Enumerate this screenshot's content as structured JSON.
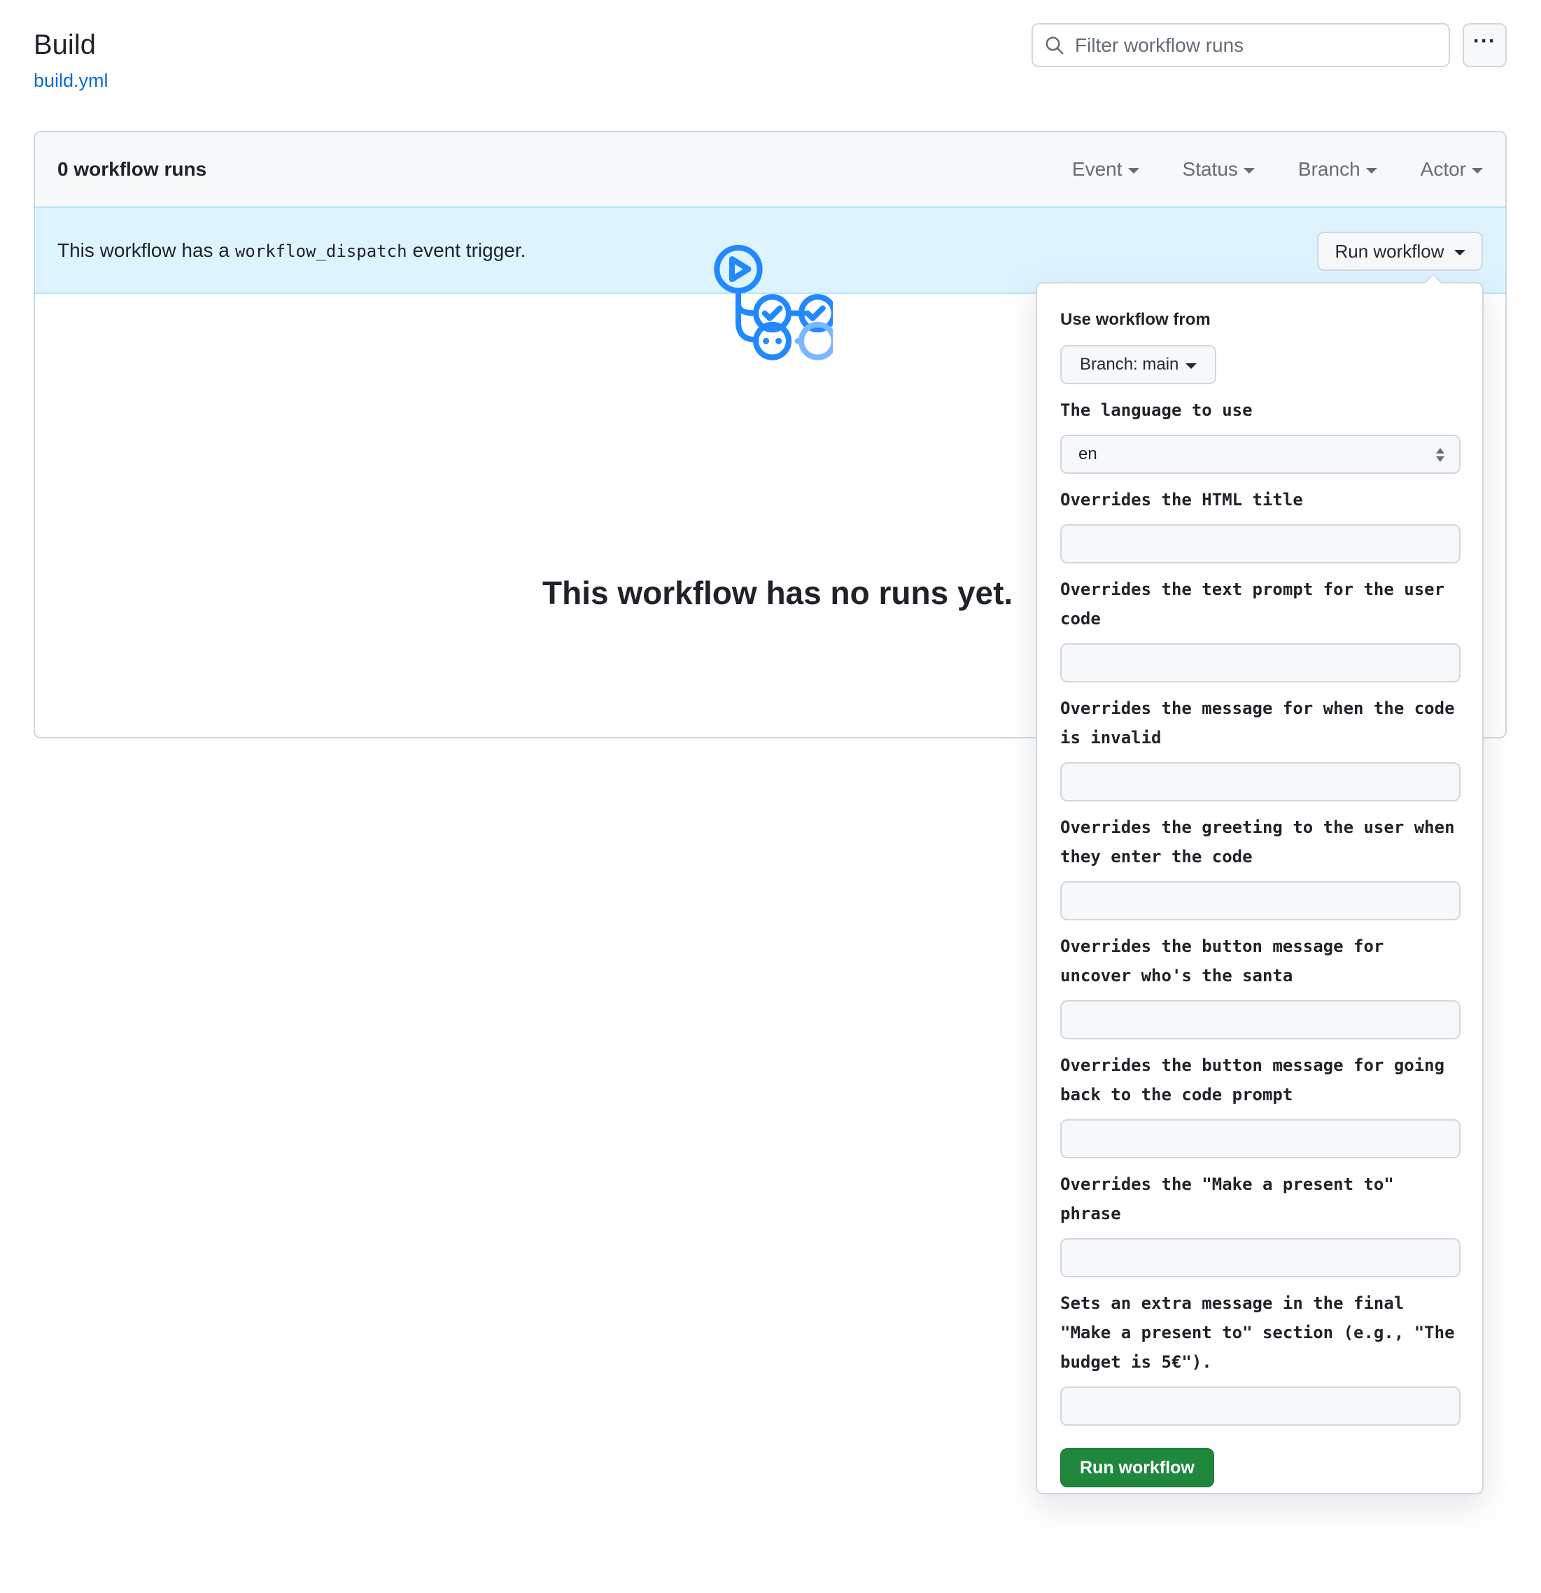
{
  "header": {
    "title": "Build",
    "file_link": "build.yml",
    "search_placeholder": "Filter workflow runs",
    "more_label": "···"
  },
  "runs": {
    "count_label": "0 workflow runs",
    "filters": [
      "Event",
      "Status",
      "Branch",
      "Actor"
    ]
  },
  "banner": {
    "text_before": "This workflow has a",
    "code": "workflow_dispatch",
    "text_after": "event trigger.",
    "run_button": "Run workflow"
  },
  "empty_state": {
    "icon": "workflow-icon",
    "heading": "This workflow has no runs yet."
  },
  "panel": {
    "use_label": "Use workflow from",
    "branch_button": "Branch: main",
    "language_label": "The language to use",
    "language_value": "en",
    "fields": [
      {
        "label": "Overrides the HTML title",
        "value": ""
      },
      {
        "label": "Overrides the text prompt for the user code",
        "value": ""
      },
      {
        "label": "Overrides the message for when the code is invalid",
        "value": ""
      },
      {
        "label": "Overrides the greeting to the user when they enter the code",
        "value": ""
      },
      {
        "label": "Overrides the button message for uncover who's the santa",
        "value": ""
      },
      {
        "label": "Overrides the button message for going back to the code prompt",
        "value": ""
      },
      {
        "label": "Overrides the \"Make a present to\" phrase",
        "value": ""
      },
      {
        "label": "Sets an extra message in the final \"Make a present to\" section (e.g., \"The budget is 5€\").",
        "value": ""
      }
    ],
    "submit": "Run workflow"
  },
  "colors": {
    "link": "#0969da",
    "banner_bg": "#ddf4ff",
    "primary_green": "#1f883d",
    "icon_blue": "#2188ff",
    "icon_light_blue": "#79b8ff"
  }
}
